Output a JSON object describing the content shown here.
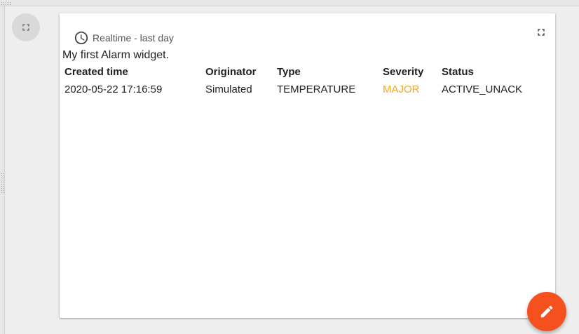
{
  "dashboard": {
    "fullscreen_icon": "fullscreen-icon",
    "edit_icon": "pencil-icon",
    "edit_button_color": "#f4511e"
  },
  "widget": {
    "timewindow": {
      "icon": "clock-icon",
      "label": "Realtime - last day"
    },
    "fullscreen_icon": "fullscreen-icon",
    "title": "My first Alarm widget.",
    "table": {
      "columns": [
        "Created time",
        "Originator",
        "Type",
        "Severity",
        "Status"
      ],
      "rows": [
        {
          "created_time": "2020-05-22 17:16:59",
          "originator": "Simulated",
          "type": "TEMPERATURE",
          "severity": "MAJOR",
          "status": "ACTIVE_UNACK"
        }
      ],
      "severity_colors": {
        "MAJOR": "#f5a623"
      }
    }
  }
}
